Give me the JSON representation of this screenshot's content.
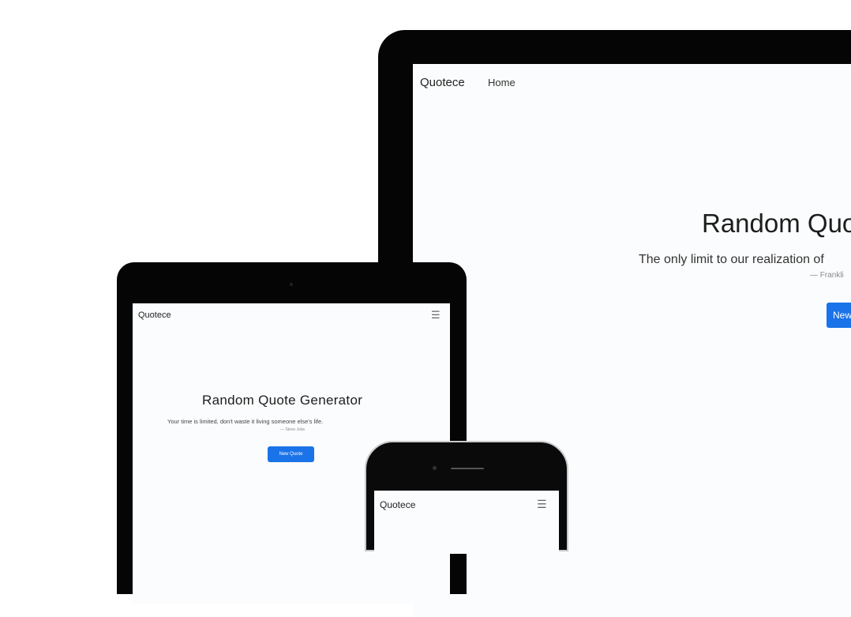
{
  "desktop": {
    "brand": "Quotece",
    "nav_home": "Home",
    "heading": "Random Quo",
    "quote": "The only limit to our realization of",
    "author": "— Frankli",
    "button_label": "New"
  },
  "tablet": {
    "brand": "Quotece",
    "menu_icon": "☰",
    "heading": "Random Quote Generator",
    "quote": "Your time is limited, don't waste it living someone else's life.",
    "author": "— Steve Jobs",
    "button_label": "New Quote"
  },
  "phone": {
    "brand": "Quotece",
    "menu_icon": "☰"
  },
  "colors": {
    "device_bezel": "#050505",
    "screen_bg": "#fbfcfd",
    "button_primary": "#1a73e8"
  }
}
